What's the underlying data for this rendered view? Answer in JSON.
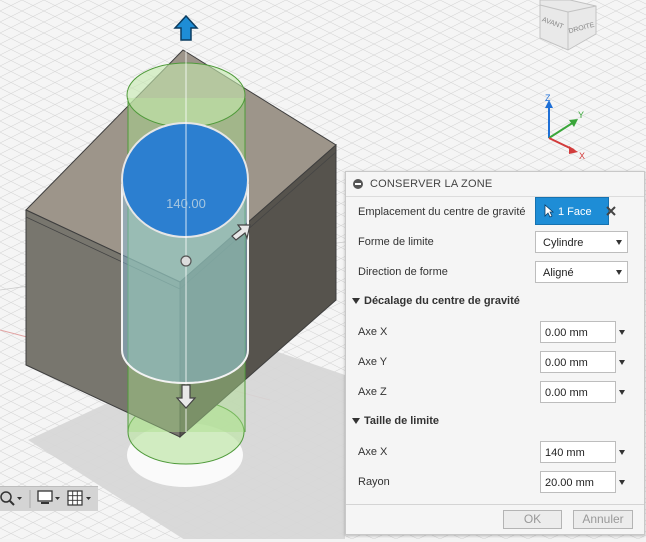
{
  "viewport": {
    "dimension_label": "140.00",
    "viewcube": {
      "front_label": "AVANT",
      "right_label": "DROITE"
    },
    "triad": {
      "z_label": "Z",
      "y_label": "Y",
      "x_label": "X"
    }
  },
  "panel": {
    "title": "CONSERVER LA ZONE",
    "centroid_location": {
      "label": "Emplacement du centre de gravité",
      "button": "1 Face"
    },
    "boundary_shape": {
      "label": "Forme de limite",
      "value": "Cylindre"
    },
    "shape_direction": {
      "label": "Direction de forme",
      "value": "Aligné"
    },
    "centroid_offset": {
      "title": "Décalage du centre de gravité",
      "rows": [
        {
          "label": "Axe X",
          "value": "0.00 mm"
        },
        {
          "label": "Axe Y",
          "value": "0.00 mm"
        },
        {
          "label": "Axe Z",
          "value": "0.00 mm"
        }
      ]
    },
    "boundary_size": {
      "title": "Taille de limite",
      "rows": [
        {
          "label": "Axe X",
          "value": "140 mm"
        },
        {
          "label": "Rayon",
          "value": "20.00 mm"
        }
      ]
    },
    "ok_label": "OK",
    "cancel_label": "Annuler"
  },
  "colors": {
    "accent": "#1e8dd6",
    "keep_zone_blue": "#2c7fd0",
    "cylinder_green": "#8fd06a",
    "box_dark": "#55524c"
  }
}
